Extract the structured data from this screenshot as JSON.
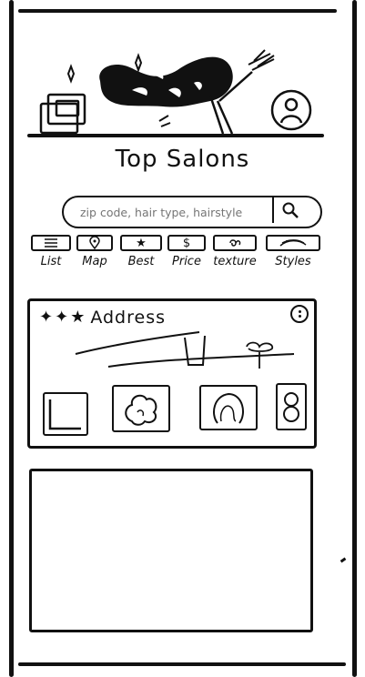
{
  "header": {
    "logo_icon": "hair-flip-person-illustration",
    "gallery_icon": "photos-icon",
    "profile_icon": "person-icon"
  },
  "page": {
    "title": "Top Salons"
  },
  "search": {
    "placeholder": "zip code, hair type, hairstyle",
    "button_icon": "search-icon"
  },
  "filters": [
    {
      "label": "List",
      "icon": "list-icon"
    },
    {
      "label": "Map",
      "icon": "map-pin-icon"
    },
    {
      "label": "Best",
      "icon": "star-icon"
    },
    {
      "label": "Price",
      "icon": "dollar-icon"
    },
    {
      "label": "texture",
      "icon": "curl-icon"
    },
    {
      "label": "Styles",
      "icon": "hair-strands-icon"
    }
  ],
  "salon_card": {
    "rating_icons": [
      "star",
      "star",
      "star"
    ],
    "address_label": "Address",
    "menu_icon": "more-vertical-icon",
    "photo_icons": [
      "photo-icon",
      "curly-hair-icon",
      "wavy-hair-icon",
      "braids-icon"
    ]
  }
}
